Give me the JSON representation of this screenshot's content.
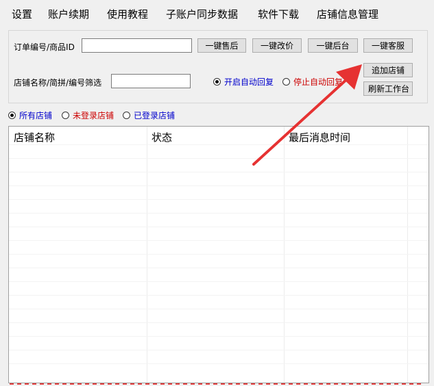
{
  "menu": [
    "设置",
    "账户续期",
    "使用教程",
    "子账户同步数据",
    "软件下载",
    "店铺信息管理"
  ],
  "filter": {
    "order_label": "订单编号/商品ID",
    "order_value": "",
    "shop_label": "店铺名称/简拼/编号筛选",
    "shop_value": ""
  },
  "buttons": {
    "after_sale": "一键售后",
    "change_price": "一键改价",
    "backend": "一键后台",
    "customer_service": "一键客服",
    "add_shop": "追加店铺",
    "refresh": "刷新工作台"
  },
  "auto_reply": {
    "start": "开启自动回复",
    "stop": "停止自动回复",
    "start_color": "#0000cc",
    "stop_color": "#cc0000",
    "selected": "start"
  },
  "shop_filter": {
    "all": "所有店铺",
    "not_logged": "未登录店铺",
    "logged": "已登录店铺",
    "all_color": "#0000cc",
    "not_logged_color": "#cc0000",
    "logged_color": "#0000cc",
    "selected": "all"
  },
  "table": {
    "columns": [
      "店铺名称",
      "状态",
      "最后消息时间"
    ],
    "rows": []
  },
  "annotation": {
    "arrow_color": "#e63232",
    "icon": "red-arrow-pointer"
  }
}
